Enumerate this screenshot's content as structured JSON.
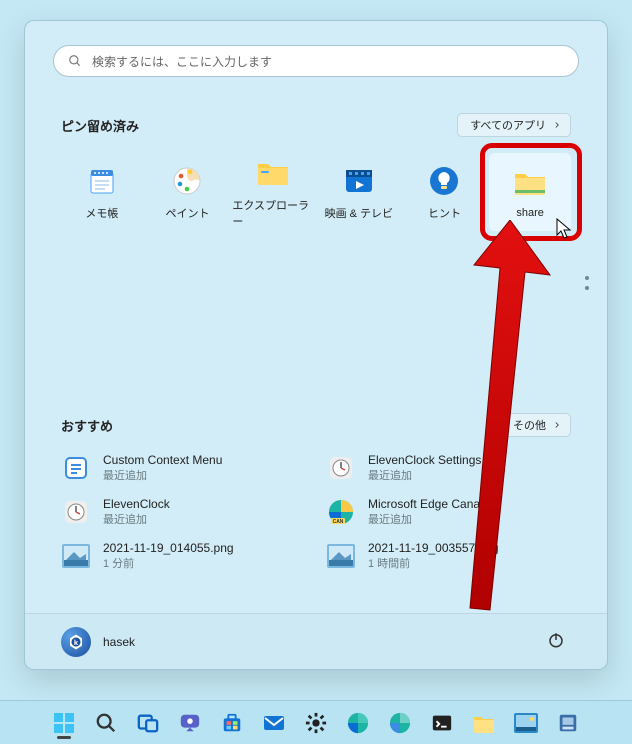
{
  "search": {
    "placeholder": "検索するには、ここに入力します"
  },
  "pinned": {
    "title": "ピン留め済み",
    "all_apps": "すべてのアプリ",
    "items": [
      {
        "label": "メモ帳"
      },
      {
        "label": "ペイント"
      },
      {
        "label": "エクスプローラー"
      },
      {
        "label": "映画 & テレビ"
      },
      {
        "label": "ヒント"
      },
      {
        "label": "share"
      }
    ]
  },
  "recommended": {
    "title": "おすすめ",
    "more": "その他",
    "items": [
      {
        "title": "Custom Context Menu",
        "subtitle": "最近追加"
      },
      {
        "title": "ElevenClock Settings",
        "subtitle": "最近追加"
      },
      {
        "title": "ElevenClock",
        "subtitle": "最近追加"
      },
      {
        "title": "Microsoft Edge Canary",
        "subtitle": "最近追加"
      },
      {
        "title": "2021-11-19_014055.png",
        "subtitle": "1 分前"
      },
      {
        "title": "2021-11-19_003557.png",
        "subtitle": "1 時間前"
      }
    ]
  },
  "footer": {
    "username": "hasek"
  }
}
